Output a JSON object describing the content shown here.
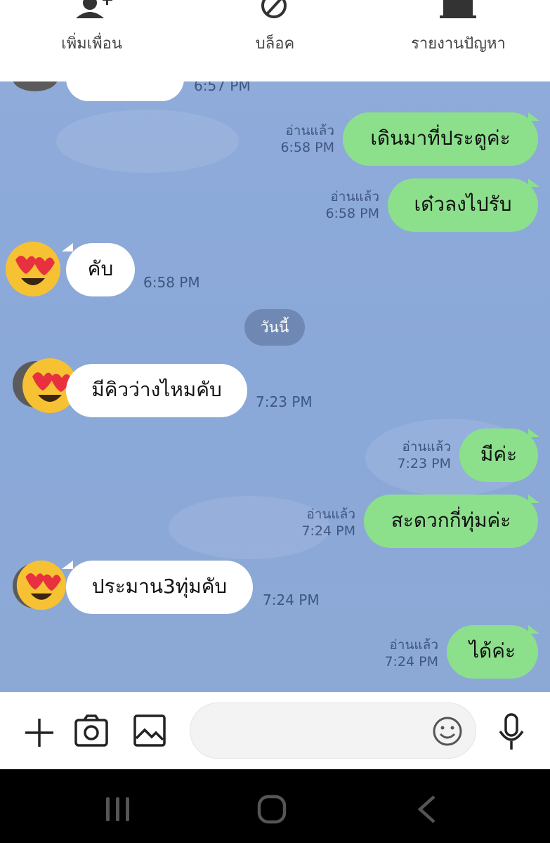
{
  "top_actions": [
    {
      "label": "เพิ่มเพื่อน",
      "icon": "add-friend-icon"
    },
    {
      "label": "บล็อค",
      "icon": "block-icon"
    },
    {
      "label": "รายงานปัญหา",
      "icon": "report-icon"
    }
  ],
  "chat": {
    "partial_time": "6:57 PM",
    "date_separator": "วันนี้",
    "read_label": "อ่านแล้ว",
    "messages": [
      {
        "dir": "out",
        "text": "เดินมาที่ประตูค่ะ",
        "time": "6:58 PM",
        "read": "อ่านแล้ว"
      },
      {
        "dir": "out",
        "text": "เด๋วลงไปรับ",
        "time": "6:58 PM",
        "read": "อ่านแล้ว"
      },
      {
        "dir": "in",
        "text": "คับ",
        "time": "6:58 PM"
      },
      {
        "dir": "in",
        "text": "มีคิวว่างไหมคับ",
        "time": "7:23 PM"
      },
      {
        "dir": "out",
        "text": "มีค่ะ",
        "time": "7:23 PM",
        "read": "อ่านแล้ว"
      },
      {
        "dir": "out",
        "text": "สะดวกกี่ทุ่มค่ะ",
        "time": "7:24 PM",
        "read": "อ่านแล้ว"
      },
      {
        "dir": "in",
        "text": "ประมาน3ทุ่มคับ",
        "time": "7:24 PM"
      },
      {
        "dir": "out",
        "text": "ได้ค่ะ",
        "time": "7:24 PM",
        "read": "อ่านแล้ว"
      }
    ]
  },
  "input_bar": {
    "icons": [
      "plus-icon",
      "camera-icon",
      "image-icon",
      "emoji-icon",
      "microphone-icon"
    ],
    "placeholder": ""
  },
  "colors": {
    "chat_bg": "#8eabda",
    "outgoing_bubble": "#8ce08c",
    "incoming_bubble": "#ffffff"
  }
}
